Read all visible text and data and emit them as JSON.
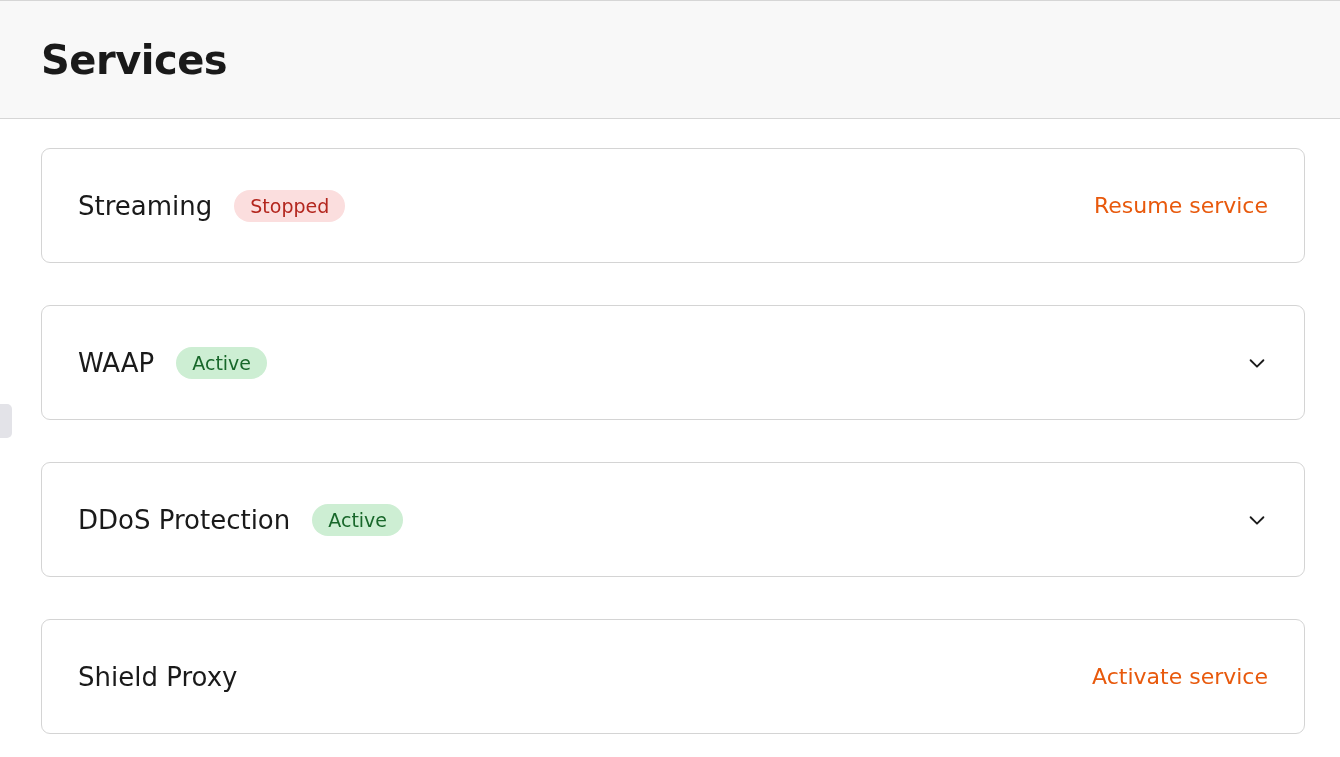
{
  "header": {
    "title": "Services"
  },
  "services": [
    {
      "name": "Streaming",
      "badge": {
        "label": "Stopped",
        "kind": "stopped"
      },
      "kind": "action",
      "action": "Resume service"
    },
    {
      "name": "WAAP",
      "badge": {
        "label": "Active",
        "kind": "active"
      },
      "kind": "expandable",
      "expanded": false
    },
    {
      "name": "DDoS Protection",
      "badge": {
        "label": "Active",
        "kind": "active"
      },
      "kind": "expandable",
      "expanded": false
    },
    {
      "name": "Shield Proxy",
      "kind": "action",
      "action": "Activate service"
    }
  ]
}
